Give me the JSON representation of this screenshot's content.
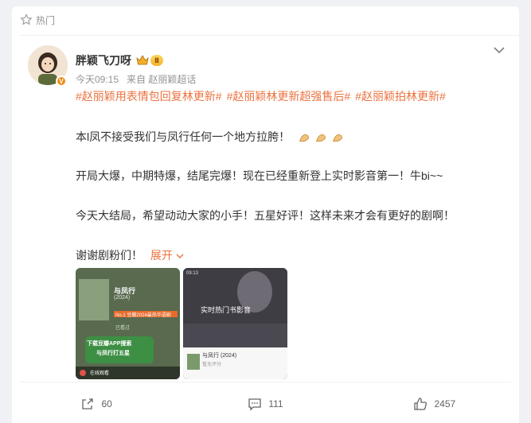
{
  "header": {
    "label": "热门"
  },
  "user": {
    "name": "胖颖飞刀呀",
    "level": "Ⅱ",
    "verified_badge": "V"
  },
  "meta": {
    "time": "今天09:15",
    "source": "来自 赵丽颖超话"
  },
  "tags": [
    "#赵丽颖用表情包回复林更新#",
    "#赵丽颖林更新超强售后#",
    "#赵丽颖拍林更新#"
  ],
  "post": {
    "line1": "本l凤不接受我们与凤行任何一个地方拉胯！",
    "line2": "开局大爆，中期特爆，结尾完爆！现在已经重新登上实时影音第一！牛bi~~",
    "line3": "今天大结局，希望动动大家的小手！五星好评！这样未来才会有更好的剧啊！",
    "line4": "谢谢剧粉们！",
    "expand_label": "展开"
  },
  "thumb1": {
    "title": "与凤行",
    "year": "(2024)",
    "rank": "No.1",
    "rank_text": "豆瓣2024最热华语剧",
    "status": "已看过",
    "banner_line1": "下载豆瓣APP搜索",
    "banner_line2": "与凤行打五星",
    "play_label": "在线观看"
  },
  "thumb2": {
    "time": "09:13",
    "heading": "实时热门书影音",
    "card_title": "与凤行 (2024)",
    "card_sub": "暂无评分"
  },
  "actions": {
    "share_count": "60",
    "comment_count": "111",
    "like_count": "2457"
  },
  "colors": {
    "accent": "#eb7340",
    "meta": "#939393"
  }
}
